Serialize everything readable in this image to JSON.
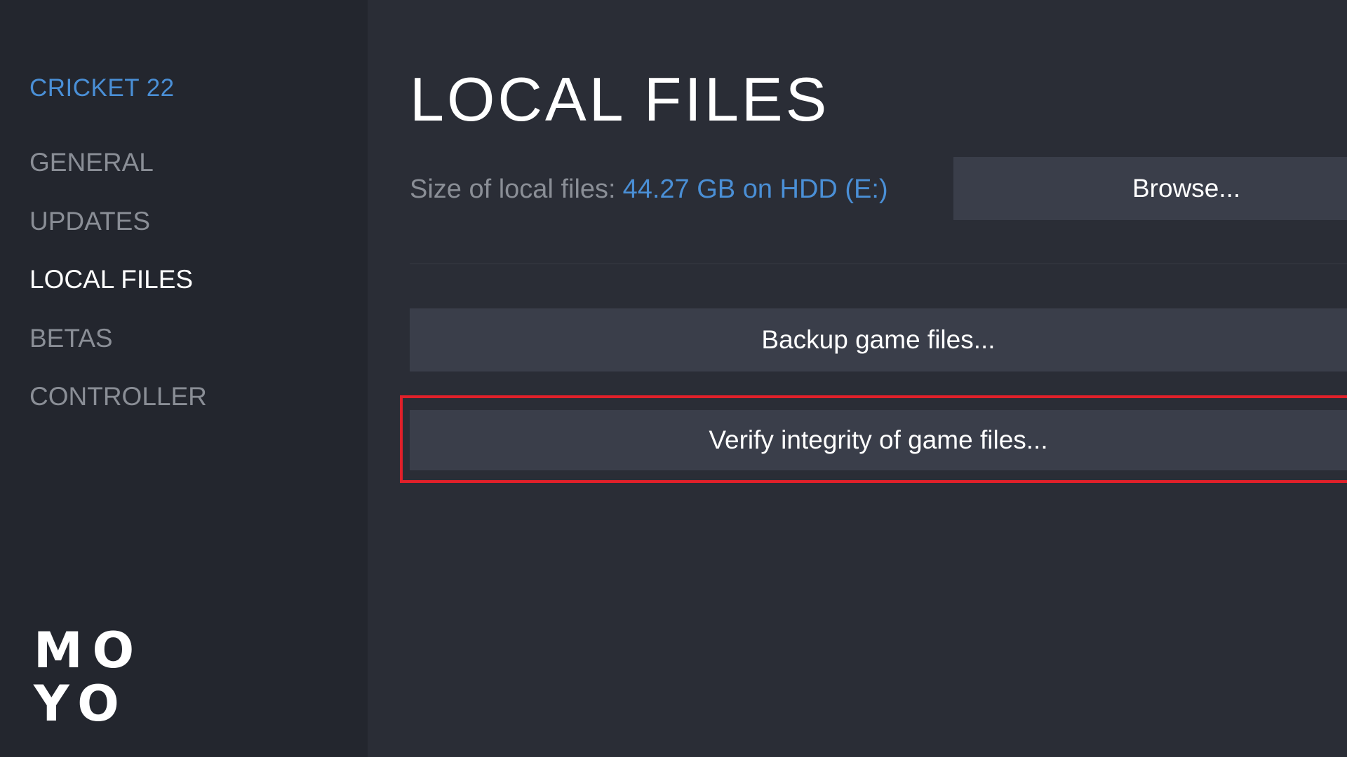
{
  "sidebar": {
    "game_title": "CRICKET 22",
    "items": [
      {
        "label": "GENERAL",
        "active": false
      },
      {
        "label": "UPDATES",
        "active": false
      },
      {
        "label": "LOCAL FILES",
        "active": true
      },
      {
        "label": "BETAS",
        "active": false
      },
      {
        "label": "CONTROLLER",
        "active": false
      }
    ]
  },
  "logo": {
    "line1": "MO",
    "line2": "YO"
  },
  "main": {
    "title": "LOCAL FILES",
    "size_label": "Size of local files:",
    "size_value": "44.27 GB on HDD (E:)",
    "browse_label": "Browse...",
    "backup_label": "Backup game files...",
    "verify_label": "Verify integrity of game files..."
  },
  "colors": {
    "accent_blue": "#4a8fd6",
    "highlight_red": "#e0202a",
    "sidebar_bg": "#23262e",
    "main_bg": "#2a2d36",
    "button_bg": "#3a3e4a"
  }
}
